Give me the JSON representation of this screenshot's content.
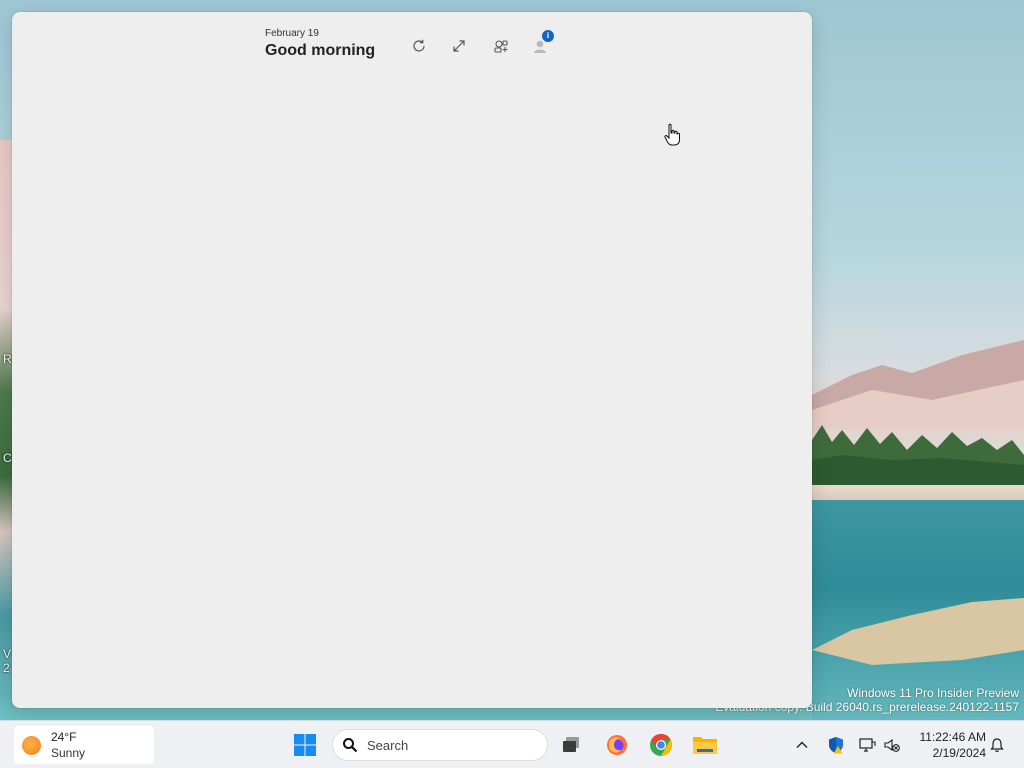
{
  "widgets": {
    "date": "February 19",
    "greeting": "Good morning",
    "buttons": {
      "refresh_icon": "refresh-icon",
      "expand_icon": "expand-icon",
      "pin_icon": "widgets-add-icon",
      "profile_icon": "user-avatar-icon"
    },
    "profile_badge": "i"
  },
  "watermark": {
    "line1": "Windows 11 Pro Insider Preview",
    "line2": "Evaluation copy. Build 26040.rs_prerelease.240122-1157"
  },
  "desktop_left_chars": [
    "R",
    "C",
    "V",
    "2"
  ],
  "taskbar": {
    "weather": {
      "temperature": "24°F",
      "condition": "Sunny"
    },
    "search_placeholder": "Search",
    "clock": {
      "time": "11:22:46 AM",
      "date": "2/19/2024"
    }
  },
  "colors": {
    "panel_bg": "#eeeeee",
    "taskbar_bg": "#eef0f3",
    "badge_blue": "#1565c0",
    "start_blue": "#1a8cf0"
  }
}
